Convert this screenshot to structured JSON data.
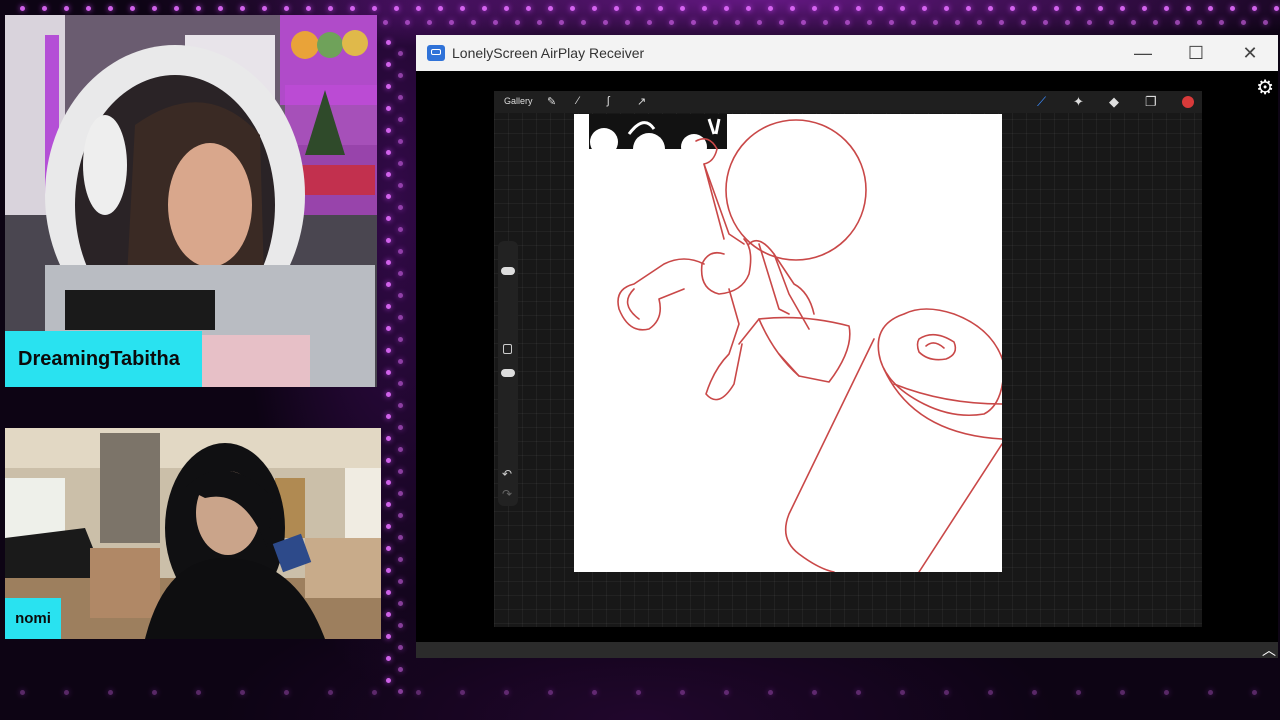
{
  "webcams": [
    {
      "name": "DreamingTabitha"
    },
    {
      "name": "nomi"
    }
  ],
  "window": {
    "title": "LonelyScreen AirPlay Receiver",
    "controls": {
      "minimize": "—",
      "maximize": "☐",
      "close": "✕"
    },
    "settings_icon": "gear-icon",
    "scroll_icon": "chevron-up-icon"
  },
  "procreate": {
    "gallery_label": "Gallery",
    "tools": [
      "wrench-icon",
      "magic-wand-icon",
      "selection-icon",
      "transform-icon"
    ],
    "right_tools": [
      "brush-icon",
      "smudge-icon",
      "eraser-icon",
      "layers-icon",
      "color-swatch"
    ],
    "color": "#d83a3a"
  },
  "colors": {
    "name_tag": "#29e2f0",
    "accent_glow": "#d24cff",
    "sketch": "#c94848"
  }
}
